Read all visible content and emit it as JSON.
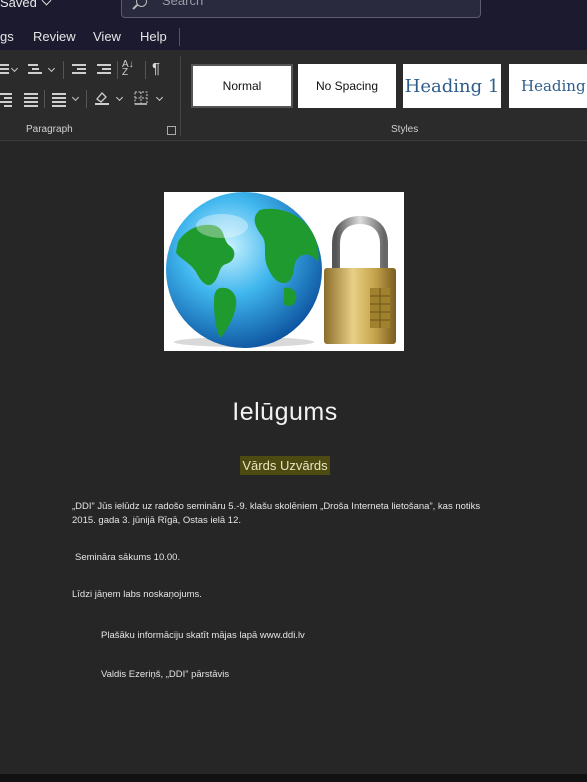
{
  "titlebar": {
    "saved_label": "Saved",
    "search_placeholder": "Search"
  },
  "menu": {
    "items": [
      "gs",
      "Review",
      "View",
      "Help"
    ]
  },
  "ribbon": {
    "paragraph_group_label": "Paragraph",
    "styles_group_label": "Styles",
    "styles": [
      {
        "label": "Normal"
      },
      {
        "label": "No Spacing"
      },
      {
        "label": "Heading 1"
      },
      {
        "label": "Heading"
      }
    ],
    "pilcrow": "¶"
  },
  "document": {
    "title": "Ielūgums",
    "name_placeholder": "Vārds Uzvārds",
    "paragraph1": "„DDI” Jūs ielūdz uz radošo semināru 5.-9. klašu skolēniem „Droša Interneta lietošana”, kas notiks 2015. gada 3. jūnijā Rīgā, Ostas ielā 12.",
    "paragraph2": "Semināra sākums 10.00.",
    "paragraph3": "Līdzi jāņem labs noskaņojums.",
    "paragraph4": "Plašāku informāciju skatīt mājas lapā www.ddi.lv",
    "paragraph5": "Valdis Ezeriņš, „DDI” pārstāvis"
  }
}
